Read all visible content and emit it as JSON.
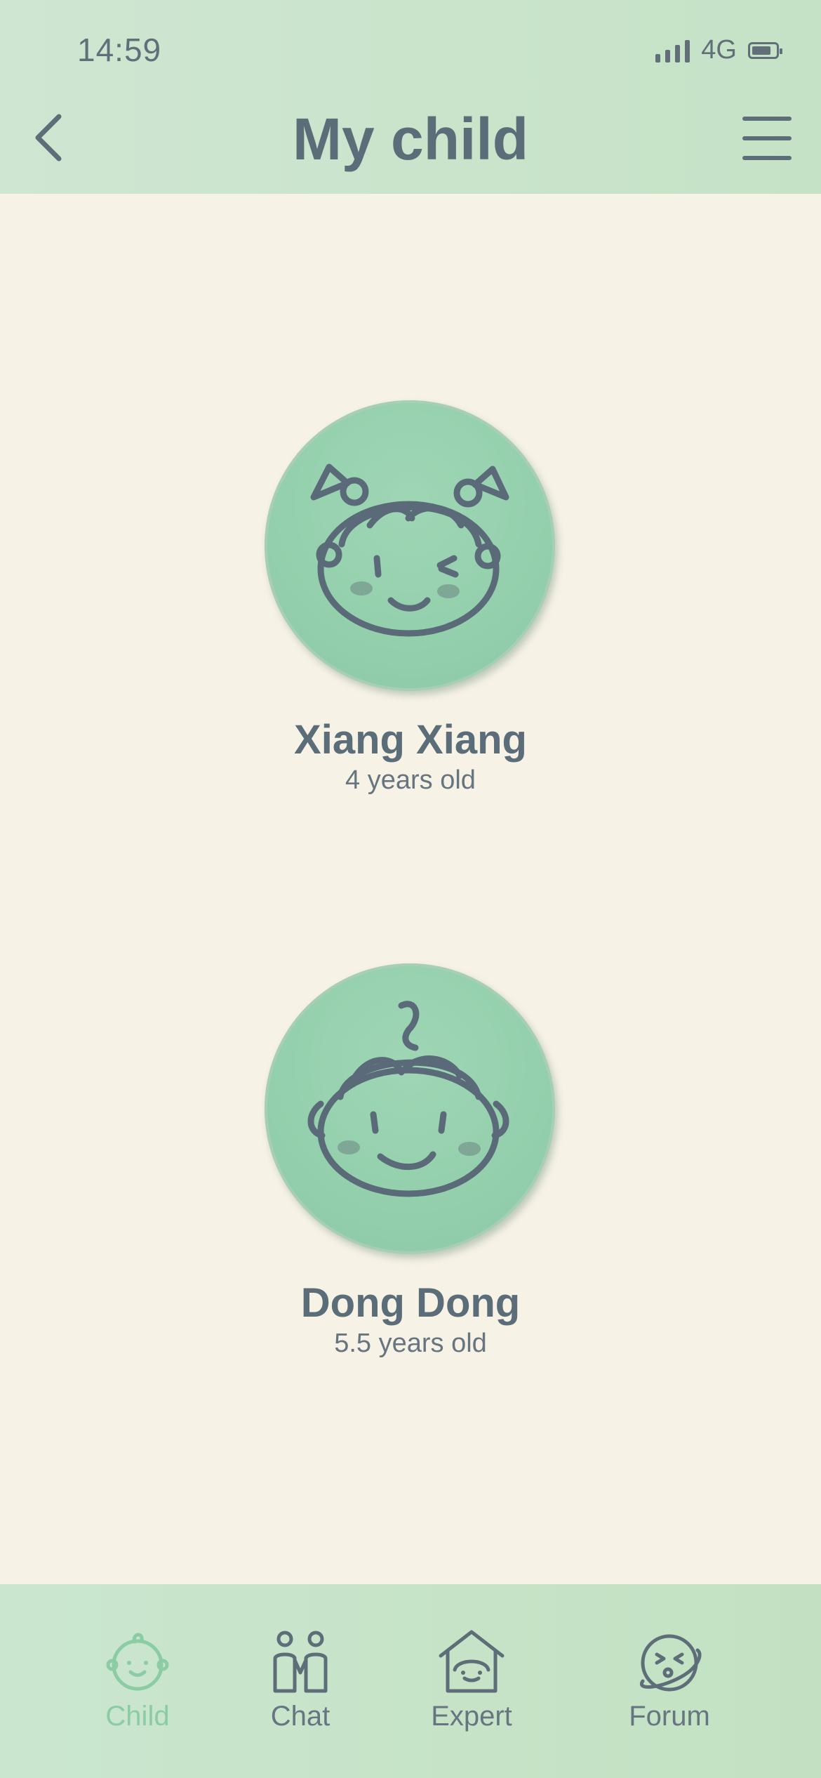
{
  "status_bar": {
    "time": "14:59",
    "network": "4G",
    "signal_icon": "signal-bars-icon",
    "battery_icon": "battery-icon"
  },
  "header": {
    "title": "My child",
    "back_icon": "chevron-left-icon",
    "menu_icon": "hamburger-menu-icon"
  },
  "children": [
    {
      "name": "Xiang Xiang",
      "age": "4 years old",
      "avatar_icon": "girl-face-icon"
    },
    {
      "name": "Dong Dong",
      "age": "5.5 years old",
      "avatar_icon": "boy-face-icon"
    }
  ],
  "tabbar": {
    "tabs": [
      {
        "label": "Child",
        "icon": "baby-face-icon",
        "active": true
      },
      {
        "label": "Chat",
        "icon": "two-people-icon",
        "active": false
      },
      {
        "label": "Expert",
        "icon": "house-face-icon",
        "active": false
      },
      {
        "label": "Forum",
        "icon": "planet-face-icon",
        "active": false
      }
    ]
  },
  "colors": {
    "header_bg": "#c7e3c9",
    "page_bg": "#f6f2e6",
    "avatar_bg": "#96d1ae",
    "active_tab": "#8bcca4",
    "text": "#5b6d78"
  }
}
